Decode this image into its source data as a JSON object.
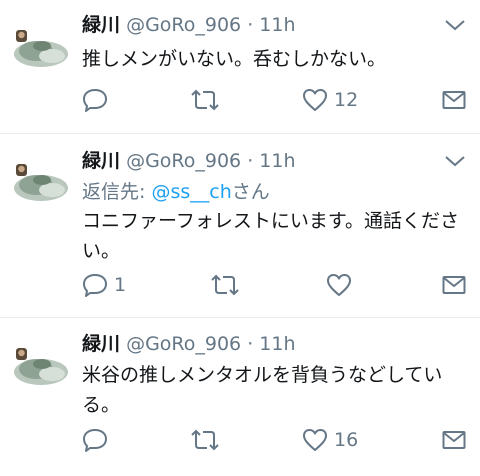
{
  "tweets": [
    {
      "name": "緑川",
      "handle": "@GoRo_906",
      "sep": "·",
      "time": "11h",
      "text": "推しメンがいない。呑むしかない。",
      "reply_count": "",
      "like_count": "12"
    },
    {
      "name": "緑川",
      "handle": "@GoRo_906",
      "sep": "·",
      "time": "11h",
      "reply_prefix": "返信先:",
      "reply_mention": "@ss__ch",
      "reply_suffix": "さん",
      "text": "コニファーフォレストにいます。通話ください。",
      "reply_count": "1",
      "like_count": ""
    },
    {
      "name": "緑川",
      "handle": "@GoRo_906",
      "sep": "·",
      "time": "11h",
      "text": "米谷の推しメンタオルを背負うなどしている。",
      "reply_count": "",
      "like_count": "16"
    }
  ],
  "icons": {
    "reply": "reply-icon",
    "retweet": "retweet-icon",
    "like": "heart-icon",
    "dm": "envelope-icon",
    "more": "chevron-down-icon"
  },
  "colors": {
    "text": "#14171a",
    "secondary": "#657786",
    "link": "#1da1f2",
    "divider": "#e6ecf0"
  }
}
